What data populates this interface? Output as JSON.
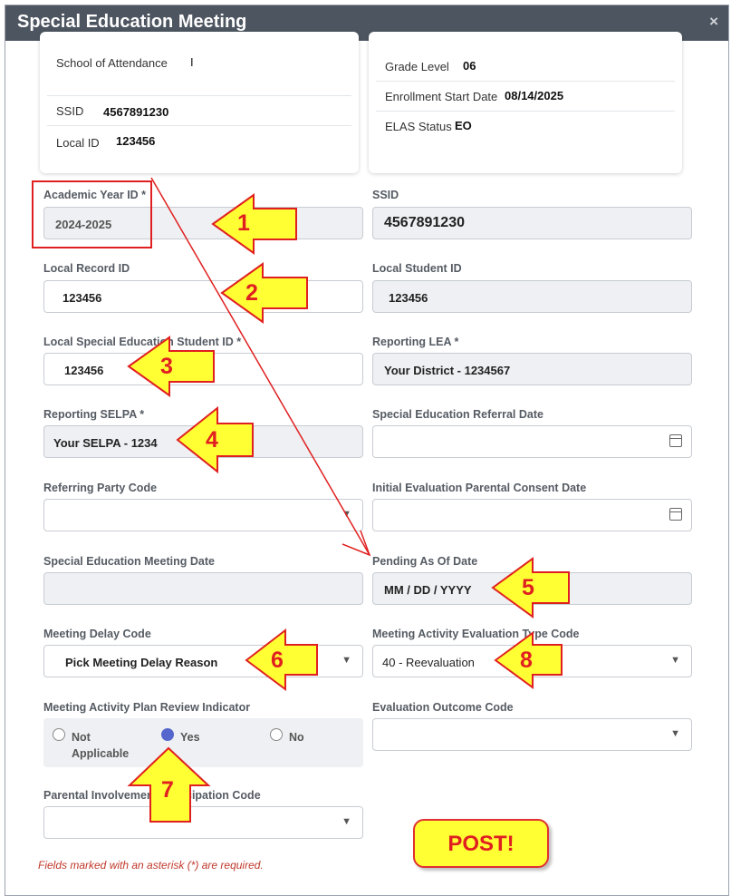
{
  "window": {
    "title": "Special Education Meeting",
    "close": "×"
  },
  "cards": {
    "left": [
      {
        "label": "School of Attendance",
        "value": "I"
      },
      {
        "label": "SSID",
        "value": "4567891230"
      },
      {
        "label": "Local ID",
        "value": "123456"
      }
    ],
    "right": [
      {
        "label": "Grade Level",
        "value": "06"
      },
      {
        "label": "Enrollment Start Date",
        "value": "08/14/2025"
      },
      {
        "label": "ELAS Status",
        "value": "EO"
      }
    ]
  },
  "form": {
    "academic_year": {
      "label": "Academic Year ID *",
      "value": "2024-2025"
    },
    "ssid": {
      "label": "SSID",
      "value": "4567891230"
    },
    "local_record": {
      "label": "Local Record ID",
      "value": "123456"
    },
    "local_student": {
      "label": "Local Student ID",
      "value": "123456"
    },
    "local_sped": {
      "label": "Local Special Education Student ID *",
      "value": "123456"
    },
    "reporting_lea": {
      "label": "Reporting LEA *",
      "value": "Your District - 1234567"
    },
    "reporting_selpa": {
      "label": "Reporting SELPA *",
      "value": "Your SELPA - 1234"
    },
    "referral_date": {
      "label": "Special Education Referral Date",
      "value": ""
    },
    "referring_party": {
      "label": "Referring Party Code",
      "value": ""
    },
    "initial_eval_date": {
      "label": "Initial Evaluation Parental Consent Date",
      "value": ""
    },
    "meeting_date": {
      "label": "Special Education Meeting Date",
      "value": ""
    },
    "pending_date": {
      "label": "Pending As Of Date",
      "value": "MM / DD / YYYY"
    },
    "meeting_delay": {
      "label": "Meeting Delay Code",
      "value": "Pick Meeting Delay Reason"
    },
    "eval_type": {
      "label": "Meeting Activity Evaluation Type Code",
      "value": "40 - Reevaluation"
    },
    "plan_review": {
      "label": "Meeting Activity Plan Review Indicator",
      "options": [
        "Not Applicable",
        "Yes",
        "No"
      ],
      "selected": "Yes"
    },
    "eval_outcome": {
      "label": "Evaluation Outcome Code",
      "value": ""
    },
    "parental_involvement": {
      "label": "Parental Involvement Participation Code",
      "value": ""
    }
  },
  "required_note": "Fields marked with an asterisk (*) are required.",
  "annotations": {
    "numbers": [
      "1",
      "2",
      "3",
      "4",
      "5",
      "6",
      "7",
      "8"
    ],
    "post_label": "POST!"
  },
  "colors": {
    "titlebar": "#4d5560",
    "arrow_fill": "#ffff33",
    "arrow_stroke": "#e02020",
    "radio_selected": "#5566cc"
  },
  "icons": {
    "dropdown": "caret-down-icon",
    "date": "calendar-icon",
    "close": "close-icon"
  }
}
